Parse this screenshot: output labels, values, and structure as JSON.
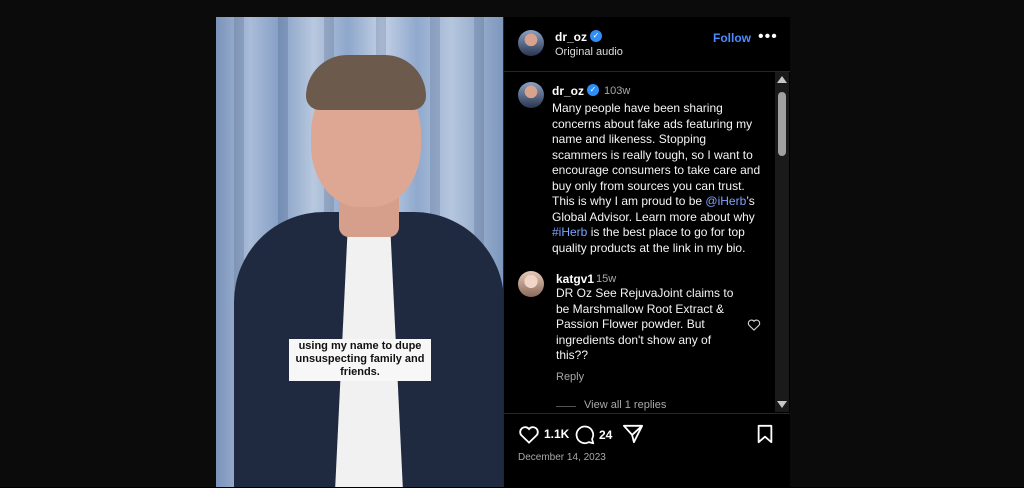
{
  "header": {
    "username": "dr_oz",
    "subtitle": "Original audio",
    "follow_label": "Follow",
    "more_label": "•••"
  },
  "video": {
    "caption": "using my name to dupe unsuspecting family and friends."
  },
  "post": {
    "username": "dr_oz",
    "time": "103w",
    "caption_parts": {
      "a": "Many people have been sharing concerns about fake ads featuring my name and likeness. Stopping scammers is really tough, so I want to encourage consumers to take care and buy only from sources you can trust. This is why I am proud to be ",
      "mention": "@iHerb",
      "b": "’s Global Advisor. Learn more about why ",
      "hashtag": "#iHerb",
      "c": " is the best place to go for top quality products at the link in my bio."
    }
  },
  "comment": {
    "username": "katgv1",
    "time": "15w",
    "text": "DR Oz See RejuvaJoint claims to be Marshmallow Root Extract & Passion Flower powder. But ingredients don't show any of this??",
    "reply_label": "Reply",
    "view_replies_label": "View all 1 replies"
  },
  "actions": {
    "likes": "1.1K",
    "comments": "24",
    "date": "December 14, 2023"
  },
  "icons": [
    "verified-icon",
    "more-icon",
    "heart-icon",
    "comment-icon",
    "share-icon",
    "bookmark-icon"
  ],
  "colors": {
    "accent": "#4a8cff",
    "verified": "#2f8ef5",
    "link": "#7da2ff"
  }
}
